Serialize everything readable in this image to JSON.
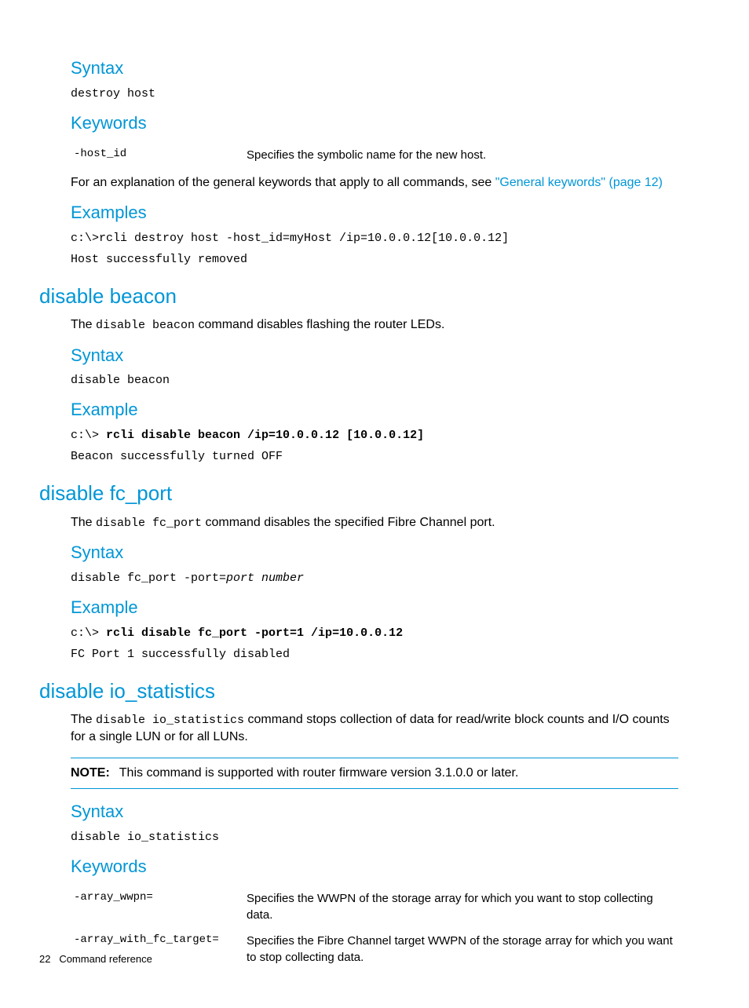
{
  "s1": {
    "syntax_h": "Syntax",
    "syntax_code": "destroy host",
    "keywords_h": "Keywords",
    "kw1_name": "-host_id",
    "kw1_desc": "Specifies the symbolic name for the new host.",
    "para_pre": "For an explanation of the general keywords that apply to all commands, see ",
    "para_link": "\"General keywords\" (page 12)",
    "examples_h": "Examples",
    "ex_line1": "c:\\>rcli destroy host -host_id=myHost /ip=10.0.0.12[10.0.0.12]",
    "ex_line2": "Host successfully removed"
  },
  "s2": {
    "title": "disable beacon",
    "intro_pre": "The ",
    "intro_code": "disable beacon",
    "intro_post": " command disables flashing the router LEDs.",
    "syntax_h": "Syntax",
    "syntax_code": "disable beacon",
    "example_h": "Example",
    "ex_prompt": "c:\\> ",
    "ex_cmd": "rcli disable beacon /ip=10.0.0.12 [10.0.0.12]",
    "ex_out": "Beacon successfully turned OFF"
  },
  "s3": {
    "title": "disable fc_port",
    "intro_pre": "The ",
    "intro_code": "disable fc_port",
    "intro_post": " command disables the specified Fibre Channel port.",
    "syntax_h": "Syntax",
    "syntax_code_pre": "disable fc_port -port=",
    "syntax_code_ital": "port number",
    "example_h": "Example",
    "ex_prompt": "c:\\> ",
    "ex_cmd": "rcli disable fc_port -port=1 /ip=10.0.0.12",
    "ex_out": "FC Port 1 successfully disabled"
  },
  "s4": {
    "title": "disable io_statistics",
    "intro_pre": "The ",
    "intro_code": "disable io_statistics",
    "intro_post": " command stops collection of data for read/write block counts and I/O counts for a single LUN or for all LUNs.",
    "note_label": "NOTE:",
    "note_text": "This command is supported with router firmware version 3.1.0.0 or later.",
    "syntax_h": "Syntax",
    "syntax_code": "disable io_statistics",
    "keywords_h": "Keywords",
    "kw1_name": "-array_wwpn=",
    "kw1_desc": "Specifies the WWPN of the storage array for which you want to stop collecting data.",
    "kw2_name": "-array_with_fc_target=",
    "kw2_desc": "Specifies the Fibre Channel target WWPN of the storage array for which you want to stop collecting data."
  },
  "footer": {
    "page": "22",
    "chapter": "Command reference"
  }
}
